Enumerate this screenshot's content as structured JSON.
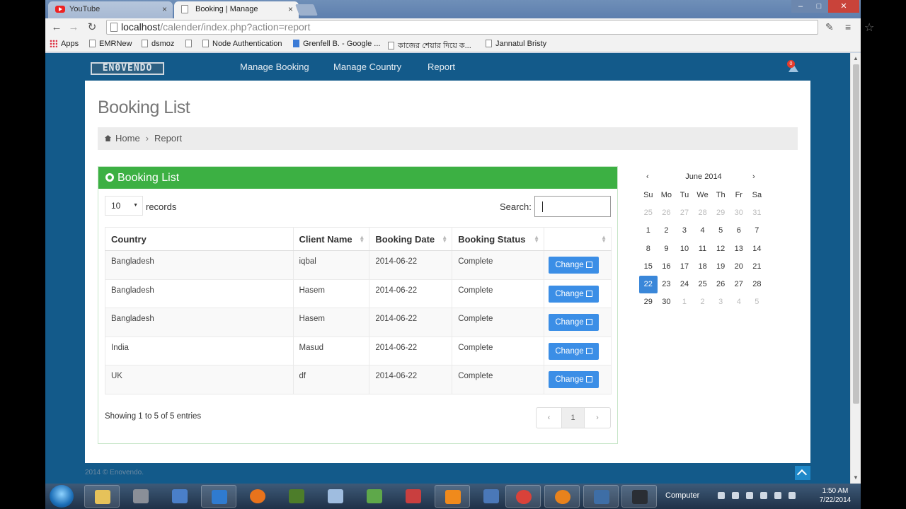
{
  "browser": {
    "tabs": [
      {
        "title": "YouTube",
        "active": false
      },
      {
        "title": "Booking | Manage",
        "active": true
      }
    ],
    "url_host": "localhost",
    "url_path": "/calender/index.php?action=report",
    "bookmarks": [
      "Apps",
      "EMRNew",
      "dsmoz",
      "",
      "Node Authentication",
      "Grenfell B. - Google ...",
      "কাজের শেয়ার দিয়ে ক...",
      "Jannatul Bristy"
    ]
  },
  "site": {
    "brand": "EN0VENDO",
    "nav": [
      "Manage Booking",
      "Manage Country",
      "Report"
    ],
    "notification_count": "0",
    "footer": "2014 © Enovendo."
  },
  "page": {
    "title": "Booking List",
    "breadcrumb": {
      "home": "Home",
      "current": "Report"
    }
  },
  "panel": {
    "title": "Booking List",
    "length_value": "10",
    "length_label": "records",
    "search_label": "Search:",
    "columns": [
      "Country",
      "Client Name",
      "Booking Date",
      "Booking Status",
      ""
    ],
    "rows": [
      {
        "country": "Bangladesh",
        "client": "iqbal",
        "date": "2014-06-22",
        "status": "Complete",
        "action": "Change"
      },
      {
        "country": "Bangladesh",
        "client": "Hasem",
        "date": "2014-06-22",
        "status": "Complete",
        "action": "Change"
      },
      {
        "country": "Bangladesh",
        "client": "Hasem",
        "date": "2014-06-22",
        "status": "Complete",
        "action": "Change"
      },
      {
        "country": "India",
        "client": "Masud",
        "date": "2014-06-22",
        "status": "Complete",
        "action": "Change"
      },
      {
        "country": "UK",
        "client": "df",
        "date": "2014-06-22",
        "status": "Complete",
        "action": "Change"
      }
    ],
    "info": "Showing 1 to 5 of 5 entries",
    "pager": {
      "prev": "‹",
      "page": "1",
      "next": "›"
    }
  },
  "calendar": {
    "month": "June 2014",
    "prev": "‹",
    "next": "›",
    "dow": [
      "Su",
      "Mo",
      "Tu",
      "We",
      "Th",
      "Fr",
      "Sa"
    ],
    "weeks": [
      [
        "25",
        "26",
        "27",
        "28",
        "29",
        "30",
        "31"
      ],
      [
        "1",
        "2",
        "3",
        "4",
        "5",
        "6",
        "7"
      ],
      [
        "8",
        "9",
        "10",
        "11",
        "12",
        "13",
        "14"
      ],
      [
        "15",
        "16",
        "17",
        "18",
        "19",
        "20",
        "21"
      ],
      [
        "22",
        "23",
        "24",
        "25",
        "26",
        "27",
        "28"
      ],
      [
        "29",
        "30",
        "1",
        "2",
        "3",
        "4",
        "5"
      ]
    ],
    "selected": "22"
  },
  "taskbar": {
    "tray_label": "Computer",
    "time": "1:50 AM",
    "date": "7/22/2014"
  },
  "colors": {
    "header_bg": "#135a8a",
    "panel_head": "#3cb043",
    "button": "#3b8ee6"
  }
}
